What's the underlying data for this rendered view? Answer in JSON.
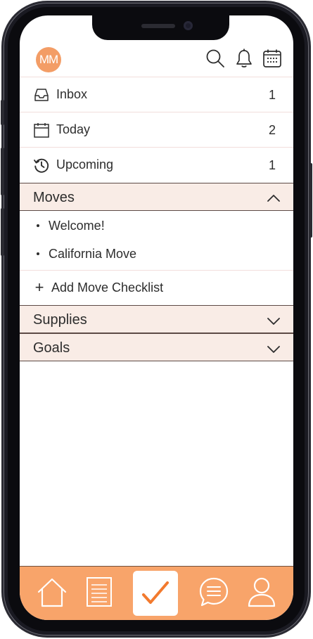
{
  "header": {
    "avatar_initials": "MM",
    "icons": [
      "search-icon",
      "bell-icon",
      "calendar-icon"
    ]
  },
  "views": [
    {
      "label": "Inbox",
      "count": "1",
      "icon": "inbox-icon"
    },
    {
      "label": "Today",
      "count": "2",
      "icon": "calendar-day-icon"
    },
    {
      "label": "Upcoming",
      "count": "1",
      "icon": "history-icon"
    }
  ],
  "sections": {
    "moves": {
      "label": "Moves",
      "expanded": true,
      "items": [
        "Welcome!",
        "California Move"
      ],
      "add_label": "Add Move Checklist"
    },
    "supplies": {
      "label": "Supplies",
      "expanded": false
    },
    "goals": {
      "label": "Goals",
      "expanded": false
    }
  },
  "bottom_nav": {
    "items": [
      "home-icon",
      "list-icon",
      "checkmark-icon",
      "chat-icon",
      "user-icon"
    ],
    "active": "checkmark-icon"
  },
  "colors": {
    "accent": "#f8a46a",
    "avatar": "#f39d66",
    "section_bg": "#f9ece6",
    "check": "#f27a2e",
    "text": "#2d2d2d"
  }
}
